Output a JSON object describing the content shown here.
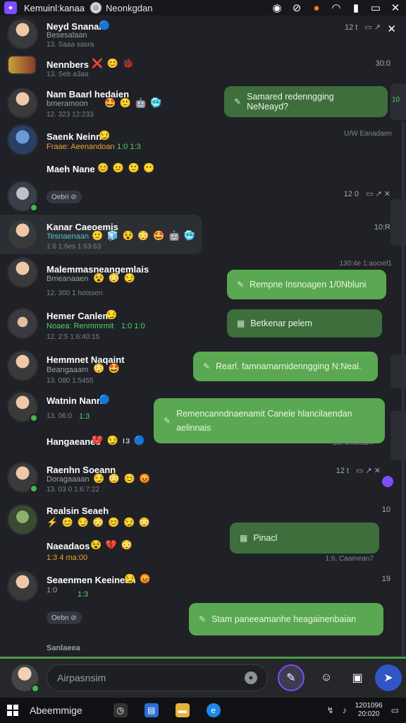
{
  "topbar": {
    "app_icon": "app-logo-icon",
    "title": "Kemuinl:kanaa",
    "subtitle": "Neonkgdan",
    "icons": [
      "record-icon",
      "clock-icon",
      "firefox-icon",
      "wifi-icon",
      "signal-icon",
      "battery-icon",
      "close-icon"
    ],
    "close_glyph": "✕"
  },
  "conversations": [
    {
      "name": "Neyd Snanai",
      "sub": "Besesalaan",
      "meta": "13. Saaa sasra",
      "emojis": "🔵",
      "time": "12 t",
      "tools": "▭  ↗"
    },
    {
      "name": "Nennbers",
      "emojis": "❌ 😊 🐞",
      "meta": "13. Seb a3aa",
      "time": "30:0"
    },
    {
      "name": "Nam Baarl hedaien",
      "sub": "bmeramoon",
      "emojis": "🤩 🙂 🤖 🥶",
      "meta": "12. 323 12:233",
      "bubble": "Samared redenngging NeNeayd?",
      "bubble_time": "10"
    },
    {
      "name": "Saenk Neinn",
      "sub": "Fraae: Aeenandoan",
      "sub_extra": "1:0 1:3",
      "emojis": "😏",
      "stamp": "U/W Eanadaen"
    },
    {
      "name": "Maeh Nane",
      "emojis": "😊 😐 🙂 😶"
    },
    {
      "chip": "Oebri ⊘",
      "time": "12 0",
      "tools": "▭ ↗ ✕"
    },
    {
      "name": "Kanar Caeoemis",
      "sub": "Tesnaenaan",
      "emojis": "🙂 🧊 😵 😳 🤩 🤖 🥶",
      "meta": "1:6 1:6es 1:63:63",
      "time": "10:R"
    },
    {
      "name": "Malemmasneangemlais",
      "sub": "Bmeanaaen",
      "emojis": "😵 😳 😏",
      "meta": "12. 300 1 hotssen",
      "bubble": "Rempne Insnoagen 1/0Nbluni",
      "stamp": "130:4e 1:aocrel1"
    },
    {
      "name": "Hemer Canlem",
      "sub": "Noaea: Renmmrmit",
      "sub_extra": "1:0 1:0",
      "emojis": "😏",
      "meta": "12. 2:5 1:6:40:15",
      "bubble": "Betkenar pelem"
    },
    {
      "name": "Hemmnet Naqaint",
      "sub": "Beangaaam",
      "emojis": "😳 🤩",
      "meta": "13. 080 1:5455",
      "bubble": "Rearl. famnamarnidenngging N:Neal."
    },
    {
      "name": "Watnin Nann",
      "sub": "1:3",
      "meta": "13. 06:0",
      "emojis": "🔵",
      "bubble": "Remencanndnaenamit Canele hlancilaendan aelinnais",
      "stamp": "23, 0m0earrr"
    },
    {
      "name": "Hangaeanes",
      "emojis": "💔 😏 ıɜ 🔵"
    },
    {
      "name": "Raenhn Soeann",
      "sub": "Doragaaaan",
      "emojis": "😏 😳 😊 😡",
      "meta": "13. 03 0 1:6:7:22",
      "time": "12 t",
      "tools": "▭ ↗ ✕"
    },
    {
      "name": "Realsin Seaeh",
      "emojis": "⚡ 😊 😏 😳 😊 😏 😳",
      "time": "10"
    },
    {
      "name": "Naeadaos",
      "sub": "1:3 4 ma:00",
      "emojis": "😵 💔 😳",
      "bubble": "Pinacl",
      "stamp": "1:6, Caamean7"
    },
    {
      "name": "Seaenmen Keeinean",
      "sub": "1:0",
      "sub_extra": "1:3",
      "emojis": "😏 😡",
      "time": "19"
    },
    {
      "chip": "Oebn ⊘",
      "bubble": "Stam  paneeamanhe heagainenbaian"
    },
    {
      "name": "Sanlaeea"
    }
  ],
  "composer": {
    "placeholder": "Airpasnsim",
    "mic_icon": "microphone-icon",
    "buttons": [
      "edit-icon",
      "emoji-icon",
      "sticker-icon",
      "send-icon"
    ]
  },
  "taskbar": {
    "search_label": "Abeemmige",
    "apps": [
      "clock-app-icon",
      "store-icon",
      "folder-icon",
      "edge-icon"
    ],
    "clock_time": "1201096",
    "clock_date": "20:020"
  },
  "colors": {
    "background": "#1f2126",
    "bubble_green": "#4c9a48",
    "accent_purple": "#7c4dff",
    "online_dot": "#3fb950"
  }
}
